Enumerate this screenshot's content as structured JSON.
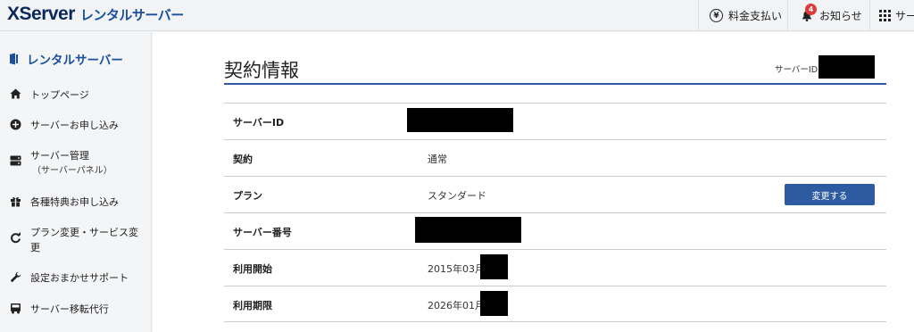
{
  "header": {
    "brand": "XServer",
    "brand_sub": "レンタルサーバー",
    "payment_label": "料金支払い",
    "notice_label": "お知らせ",
    "notice_count": "4",
    "apps_label": "サーバー"
  },
  "sidebar": {
    "title": "レンタルサーバー",
    "items": [
      {
        "label": "トップページ",
        "icon": "home-icon"
      },
      {
        "label": "サーバーお申し込み",
        "icon": "plus-circle-icon"
      },
      {
        "label": "サーバー管理",
        "sub": "（サーバーパネル）",
        "icon": "server-icon"
      },
      {
        "label": "各種特典お申し込み",
        "icon": "gift-icon"
      },
      {
        "label": "プラン変更・サービス変",
        "label2": "更",
        "icon": "refresh-icon"
      },
      {
        "label": "設定おまかせサポート",
        "icon": "wrench-icon"
      },
      {
        "label": "サーバー移転代行",
        "icon": "truck-icon"
      }
    ]
  },
  "main": {
    "title": "契約情報",
    "server_id_label": "サーバーID",
    "rows": [
      {
        "key": "サーバーID",
        "value": ""
      },
      {
        "key": "契約",
        "value": "通常"
      },
      {
        "key": "プラン",
        "value": "スタンダード"
      },
      {
        "key": "サーバー番号",
        "value": ""
      },
      {
        "key": "利用開始",
        "value": "2015年03月"
      },
      {
        "key": "利用期限",
        "value": "2026年01月"
      }
    ],
    "change_button": "変更する"
  },
  "colors": {
    "brand_dark": "#0b2a5b",
    "accent": "#2d5aa0",
    "badge": "#e03a3a"
  }
}
